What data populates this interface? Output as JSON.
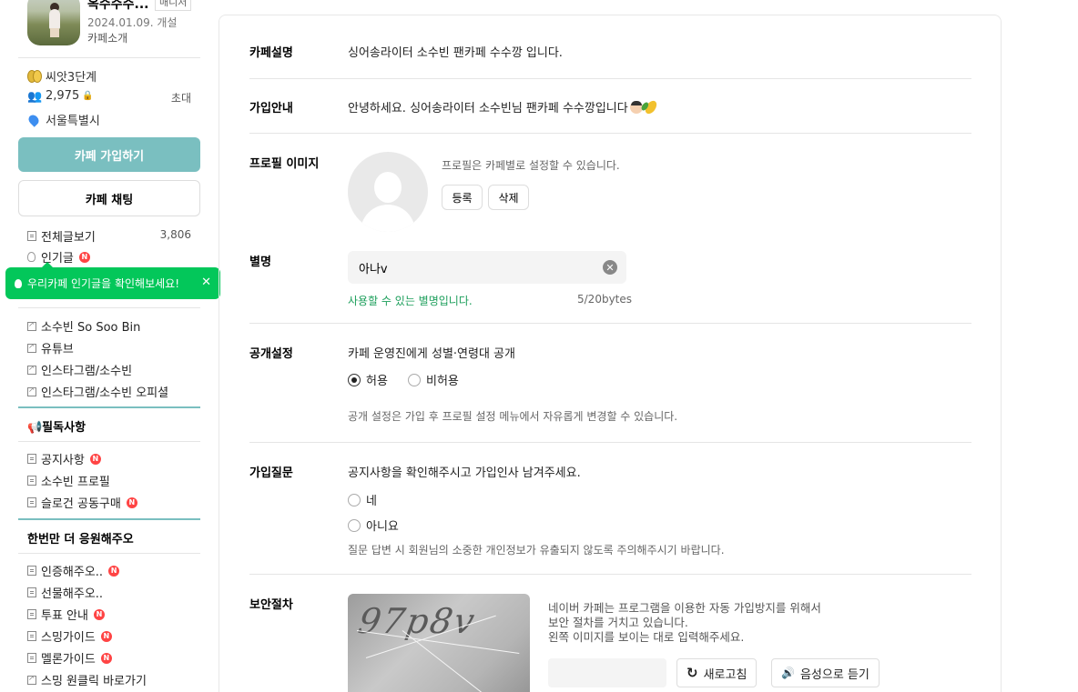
{
  "sidebar": {
    "cafe_name": "옥수수수...",
    "manager_badge": "매니저",
    "open_date": "2024.01.09. 개설",
    "cafe_intro": "카페소개",
    "level": "씨앗3단계",
    "member_count": "2,975",
    "invite": "초대",
    "location": "서울특별시",
    "join_button": "카페 가입하기",
    "chat_button": "카페 채팅",
    "all_posts": "전체글보기",
    "all_posts_count": "3,806",
    "popular": "인기글",
    "tooltip": "우리카페 인기글을 확인해보세요!",
    "links": [
      "소수빈 So Soo Bin",
      "유튜브",
      "인스타그램/소수빈",
      "인스타그램/소수빈 오피셜"
    ],
    "group1_title": "📢필독사항",
    "group1_items": [
      "공지사항",
      "소수빈 프로필",
      "슬로건 공동구매"
    ],
    "group2_title": "한번만 더 응원해주오",
    "group2_items": [
      "인증해주오..",
      "선물해주오..",
      "투표 안내",
      "스밍가이드",
      "멜론가이드",
      "스밍 원클릭 바로가기"
    ],
    "new_label": "N"
  },
  "form": {
    "desc_label": "카페설명",
    "desc_text": "싱어송라이터 소수빈 팬카페 수수깡 입니다.",
    "guide_label": "가입안내",
    "guide_text": "안녕하세요. 싱어송라이터 소수빈님 팬카페 수수깡입니다",
    "profile_label": "프로필 이미지",
    "profile_hint": "프로필은 카페별로 설정할 수 있습니다.",
    "register_btn": "등록",
    "delete_btn": "삭제",
    "nickname_label": "별명",
    "nickname_value": "아나v",
    "nickname_ok": "사용할 수 있는 별명입니다.",
    "nickname_bytes": "5/20bytes",
    "public_label": "공개설정",
    "public_text": "카페 운영진에게 성별·연령대 공개",
    "allow": "허용",
    "deny": "비허용",
    "public_hint": "공개 설정은 가입 후 프로필 설정 메뉴에서 자유롭게 변경할 수 있습니다.",
    "question_label": "가입질문",
    "question_text": "공지사항을 확인해주시고 가입인사 남겨주세요.",
    "yes": "네",
    "no": "아니요",
    "question_hint": "질문 답변 시 회원님의 소중한 개인정보가 유출되지 않도록 주의해주시기 바랍니다.",
    "security_label": "보안절차",
    "captcha_text": "97p8v",
    "security_info": [
      "네이버 카페는 프로그램을 이용한 자동 가입방지를 위해서",
      "보안 절차를 거치고 있습니다.",
      "왼쪽 이미지를 보이는 대로 입력해주세요."
    ],
    "refresh_btn": "새로고침",
    "audio_btn": "음성으로 듣기"
  },
  "colors": {
    "accent": "#7abfc0",
    "tooltip": "#03c75a",
    "ok": "#1b9e5a",
    "new": "#ff4444"
  }
}
